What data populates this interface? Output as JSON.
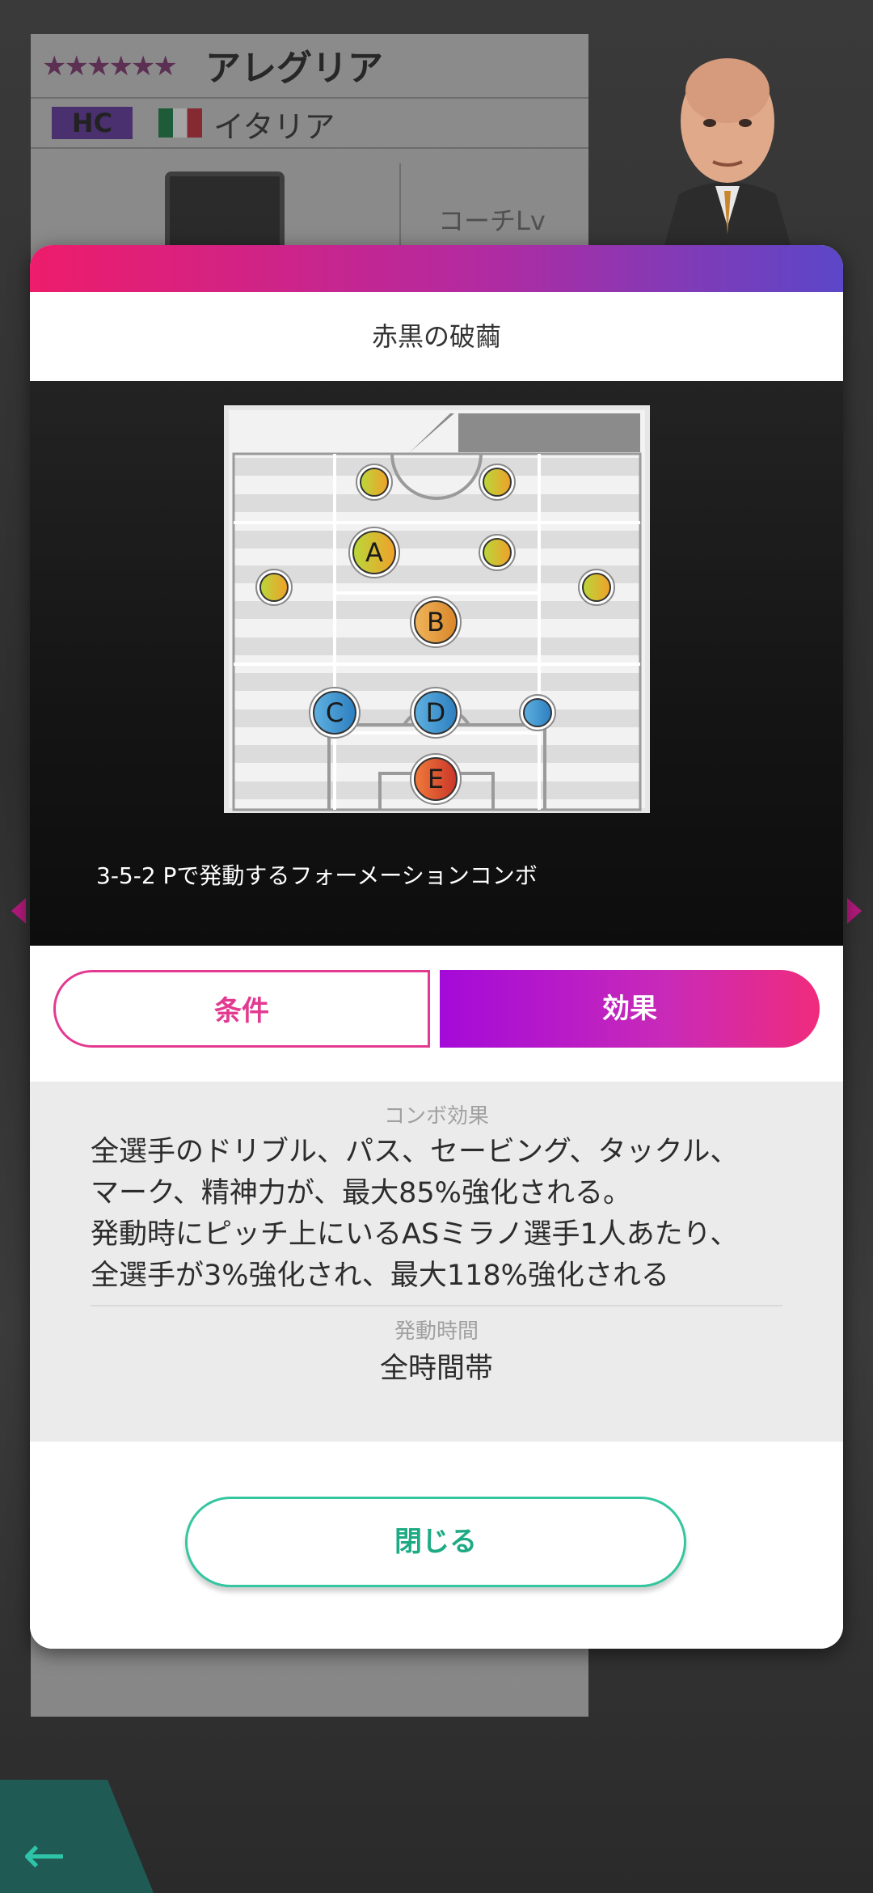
{
  "background_card": {
    "rarity_stars": "★★★★★★",
    "coach_name": "アレグリア",
    "role_badge": "HC",
    "country": "イタリア",
    "coach_level_label": "コーチLv"
  },
  "modal": {
    "title": "赤黒の破繭",
    "formation_description": "3-5-2 Pで発動するフォーメーションコンボ",
    "positions": [
      {
        "label": "",
        "color": "green"
      },
      {
        "label": "",
        "color": "green"
      },
      {
        "label": "A",
        "color": "green"
      },
      {
        "label": "",
        "color": "green"
      },
      {
        "label": "",
        "color": "green"
      },
      {
        "label": "",
        "color": "green"
      },
      {
        "label": "B",
        "color": "orange"
      },
      {
        "label": "C",
        "color": "blue"
      },
      {
        "label": "D",
        "color": "blue"
      },
      {
        "label": "",
        "color": "blue"
      },
      {
        "label": "E",
        "color": "red"
      }
    ],
    "tabs": {
      "condition": "条件",
      "effect": "効果",
      "active": "effect"
    },
    "combo_effect_label": "コンボ効果",
    "combo_effect_text": "全選手のドリブル、パス、セービング、タックル、\nマーク、精神力が、最大85%強化される。\n発動時にピッチ上にいるASミラノ選手1人あたり、\n全選手が3%強化され、最大118%強化される",
    "activation_time_label": "発動時間",
    "activation_time_value": "全時間帯",
    "close_label": "閉じる"
  },
  "colors": {
    "header_gradient": [
      "#ee1c6b",
      "#b32aa0",
      "#5b47c8"
    ],
    "tab_condition": "#e33a91",
    "tab_effect_gradient": [
      "#a40ad8",
      "#f02b7c"
    ],
    "close_button": "#33c6a0"
  }
}
